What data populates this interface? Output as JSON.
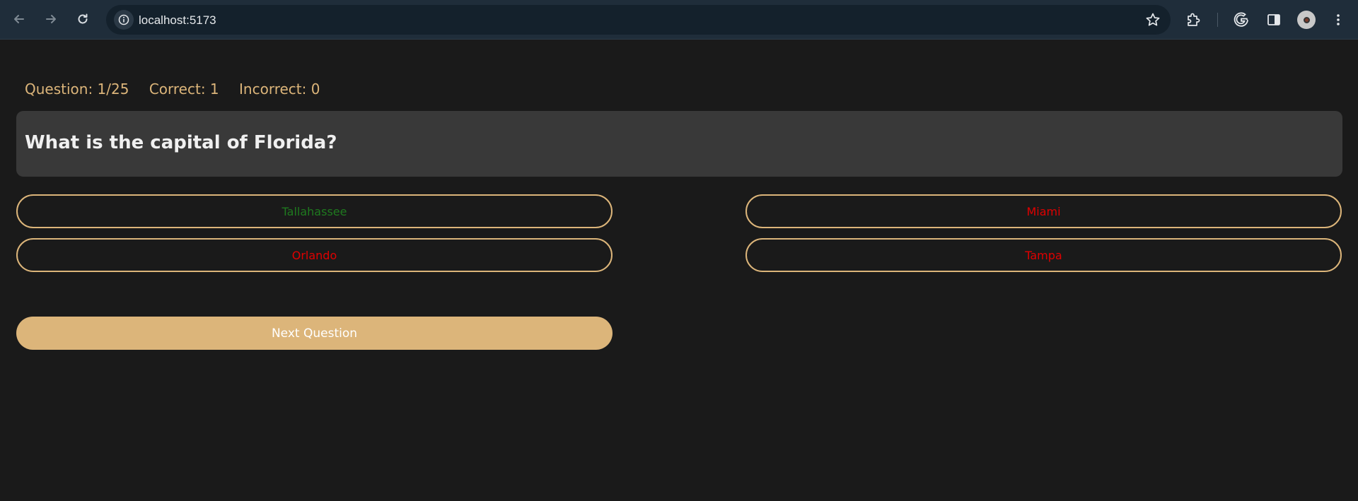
{
  "browser": {
    "url": "localhost:5173",
    "icons": [
      "back-icon",
      "forward-icon",
      "reload-icon",
      "site-info-icon",
      "bookmark-star-icon",
      "extensions-icon",
      "google-icon",
      "side-panel-icon",
      "profile-avatar",
      "menu-kebab-icon"
    ]
  },
  "quiz": {
    "stats": {
      "question": "Question: 1/25",
      "correct": "Correct: 1",
      "incorrect": "Incorrect: 0"
    },
    "question": "What is the capital of Florida?",
    "answers": [
      {
        "label": "Tallahassee",
        "state": "correct",
        "color": "#1f7a1f"
      },
      {
        "label": "Miami",
        "state": "wrong",
        "color": "#e00000"
      },
      {
        "label": "Orlando",
        "state": "wrong",
        "color": "#e00000"
      },
      {
        "label": "Tampa",
        "state": "wrong",
        "color": "#e00000"
      }
    ],
    "next_label": "Next Question"
  },
  "colors": {
    "accent": "#dcb57a",
    "background": "#1a1a1a",
    "question_bg": "#393939"
  }
}
